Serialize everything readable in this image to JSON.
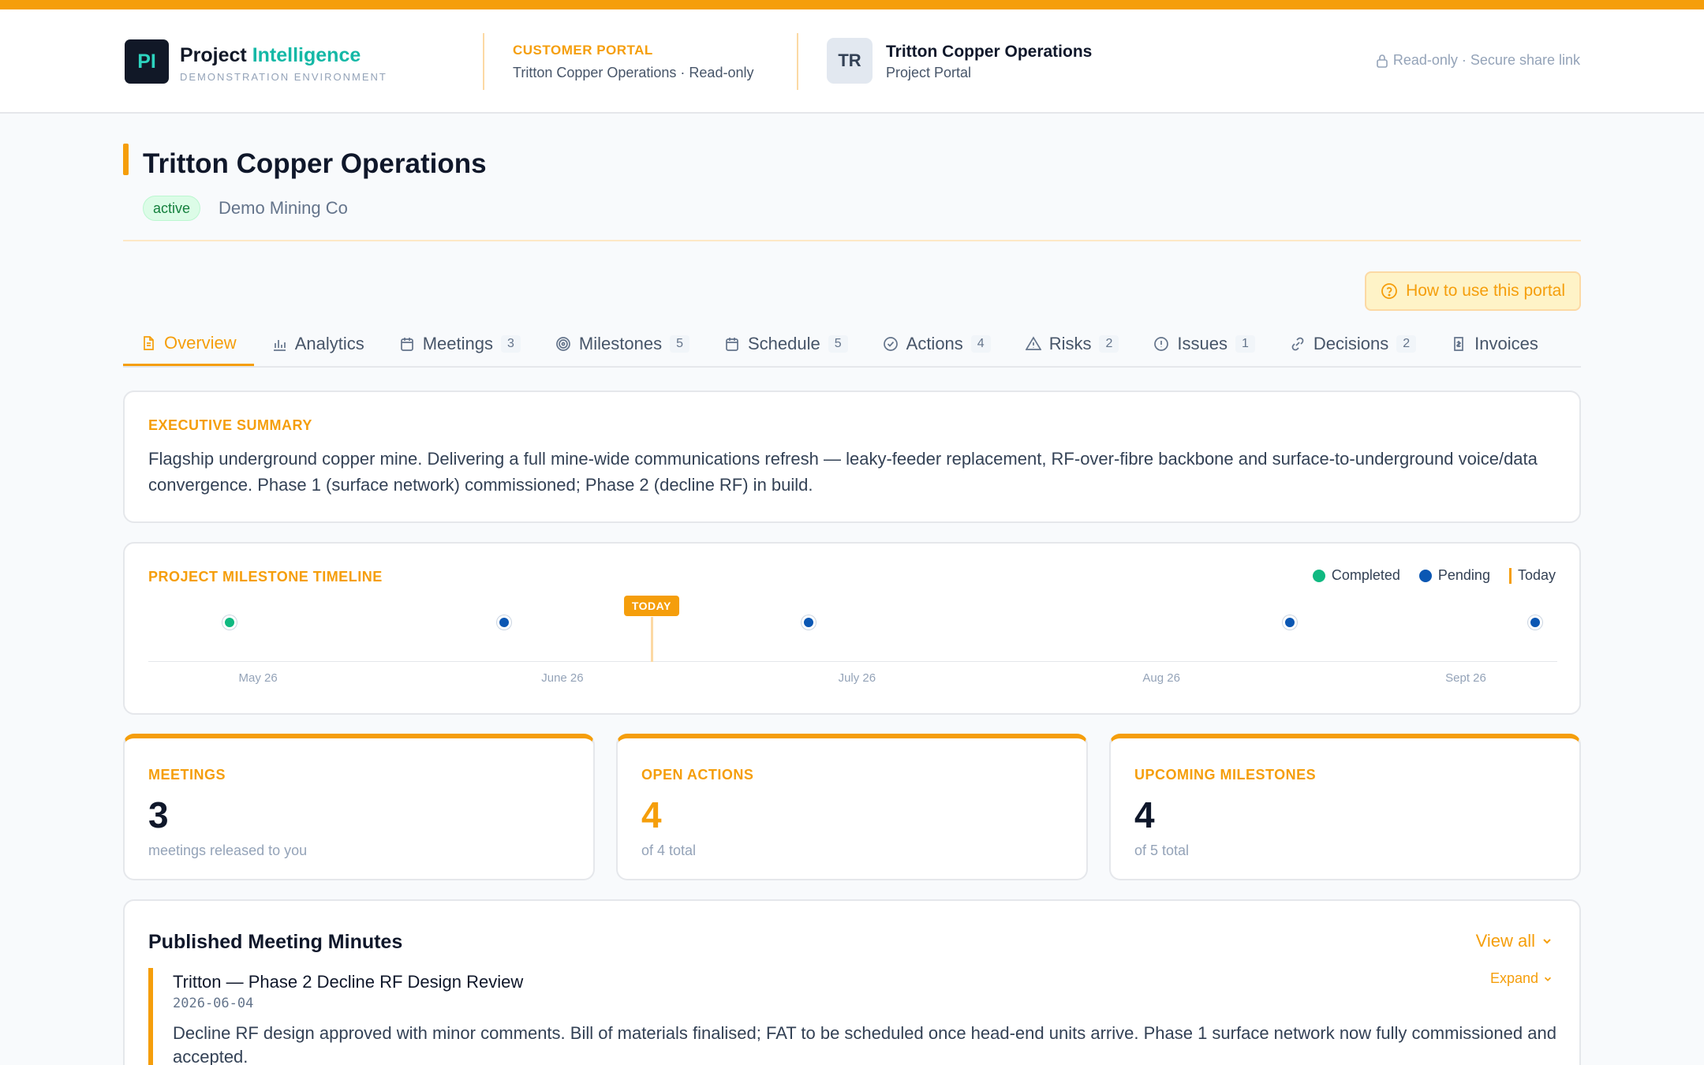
{
  "brand": {
    "logo": "PI",
    "name_prefix": "Project",
    "name_accent": "Intelligence",
    "subtitle": "DEMONSTRATION ENVIRONMENT"
  },
  "portal": {
    "label": "CUSTOMER PORTAL",
    "sub": "Tritton Copper Operations · Read-only"
  },
  "customer": {
    "avatar": "TR",
    "name": "Tritton Copper Operations",
    "sub": "Project Portal"
  },
  "access": {
    "label": "Read-only · Secure share link",
    "icon": "lock-icon"
  },
  "page": {
    "title": "Tritton Copper Operations",
    "status": "active",
    "client": "Demo Mining Co"
  },
  "help_button": {
    "label": "How to use this portal",
    "icon": "help-circle-icon"
  },
  "tabs": [
    {
      "label": "Overview",
      "count": "",
      "icon": "document-icon",
      "active": true
    },
    {
      "label": "Analytics",
      "count": "",
      "icon": "bar-chart-icon"
    },
    {
      "label": "Meetings",
      "count": "3",
      "icon": "calendar-icon"
    },
    {
      "label": "Milestones",
      "count": "5",
      "icon": "target-icon"
    },
    {
      "label": "Schedule",
      "count": "5",
      "icon": "calendar-icon"
    },
    {
      "label": "Actions",
      "count": "4",
      "icon": "check-circle-icon"
    },
    {
      "label": "Risks",
      "count": "2",
      "icon": "warning-triangle-icon"
    },
    {
      "label": "Issues",
      "count": "1",
      "icon": "alert-circle-icon"
    },
    {
      "label": "Decisions",
      "count": "2",
      "icon": "link-icon"
    },
    {
      "label": "Invoices",
      "count": "",
      "icon": "invoice-icon"
    }
  ],
  "summary": {
    "label": "EXECUTIVE SUMMARY",
    "text": "Flagship underground copper mine. Delivering a full mine-wide communications refresh — leaky-feeder replacement, RF-over-fibre backbone and surface-to-underground voice/data convergence. Phase 1 (surface network) commissioned; Phase 2 (decline RF) in build."
  },
  "timeline": {
    "label": "PROJECT MILESTONE TIMELINE",
    "legend": {
      "completed": "Completed",
      "pending": "Pending",
      "today": "Today"
    },
    "today_tag": "TODAY",
    "colors": {
      "completed": "#10b981",
      "pending": "#0b57b3",
      "today": "#f59e0b"
    }
  },
  "chart_data": {
    "type": "scatter",
    "title": "PROJECT MILESTONE TIMELINE",
    "x_axis": {
      "type": "date",
      "range": [
        "2026-05-19",
        "2026-10-05"
      ],
      "ticks": [
        "May 26",
        "June 26",
        "July 26",
        "Aug 26",
        "Sept 26"
      ],
      "tick_dates": [
        "2026-05-26",
        "2026-06-26",
        "2026-07-26",
        "2026-08-26",
        "2026-09-26"
      ]
    },
    "today": "2026-07-07",
    "series": [
      {
        "name": "Completed",
        "color": "#10b981",
        "points": [
          "2026-05-25"
        ]
      },
      {
        "name": "Pending",
        "color": "#0b57b3",
        "points": [
          "2026-06-22",
          "2026-07-23",
          "2026-09-10",
          "2026-10-05"
        ]
      }
    ]
  },
  "stats": [
    {
      "label": "MEETINGS",
      "value": "3",
      "sub": "meetings released to you"
    },
    {
      "label": "OPEN ACTIONS",
      "value": "4",
      "sub": "of 4 total"
    },
    {
      "label": "UPCOMING MILESTONES",
      "value": "4",
      "sub": "of 5 total"
    }
  ],
  "minutes": {
    "title": "Published Meeting Minutes",
    "view_all": "View all",
    "items": [
      {
        "title": "Tritton — Phase 2 Decline RF Design Review",
        "date": "2026-06-04",
        "expand": "Expand",
        "summary": "Decline RF design approved with minor comments. Bill of materials finalised; FAT to be scheduled once head-end units arrive. Phase 1 surface network now fully commissioned and accepted."
      }
    ]
  }
}
